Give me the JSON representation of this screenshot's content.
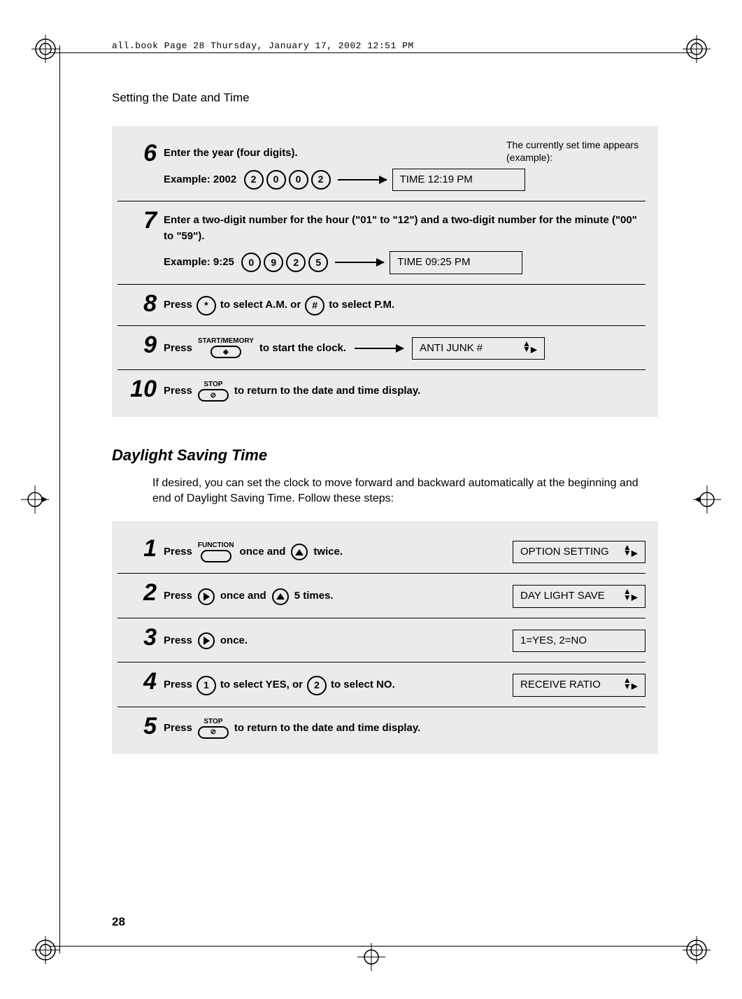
{
  "meta_header": "all.book  Page 28  Thursday, January 17, 2002  12:51 PM",
  "page_header": "Setting the Date and Time",
  "page_number": "28",
  "block1": {
    "steps": [
      {
        "num": "6",
        "text": "Enter the year (four digits).",
        "example_label": "Example: 2002",
        "keys": [
          "2",
          "0",
          "0",
          "2"
        ],
        "note": "The currently set time appears (example):",
        "display": "TIME 12:19 PM"
      },
      {
        "num": "7",
        "text": "Enter a two-digit number for the hour (\"01\" to \"12\") and a two-digit number for the minute (\"00\" to \"59\").",
        "example_label": "Example: 9:25",
        "keys": [
          "0",
          "9",
          "2",
          "5"
        ],
        "display": "TIME 09:25 PM"
      },
      {
        "num": "8",
        "press": "Press",
        "key1": "*",
        "mid": " to select A.M. or ",
        "key2": "#",
        "end": " to select P.M."
      },
      {
        "num": "9",
        "press": "Press",
        "oval_label": "START/MEMORY",
        "end": " to start the clock.",
        "display": "ANTI JUNK #"
      },
      {
        "num": "10",
        "press": "Press",
        "oval_label": "STOP",
        "end": " to return to the date and time display."
      }
    ]
  },
  "section2_title": "Daylight Saving Time",
  "section2_body": "If desired, you can set the clock to move forward and backward automatically at the beginning and end of Daylight Saving Time. Follow these steps:",
  "block2": {
    "steps": [
      {
        "num": "1",
        "press": "Press",
        "oval_label": "FUNCTION",
        "mid": " once and ",
        "arrow": "up",
        "end": " twice.",
        "display": "OPTION SETTING"
      },
      {
        "num": "2",
        "press": "Press",
        "arrow1": "right",
        "mid": " once and ",
        "arrow2": "up",
        "end": " 5 times.",
        "display": "DAY LIGHT SAVE"
      },
      {
        "num": "3",
        "press": "Press",
        "arrow1": "right",
        "end": " once.",
        "display": "1=YES, 2=NO"
      },
      {
        "num": "4",
        "press": "Press",
        "key1": "1",
        "mid": " to select YES, or ",
        "key2": "2",
        "end": " to select NO.",
        "display": "RECEIVE RATIO"
      },
      {
        "num": "5",
        "press": "Press",
        "oval_label": "STOP",
        "end": " to return to the date and time display."
      }
    ]
  }
}
